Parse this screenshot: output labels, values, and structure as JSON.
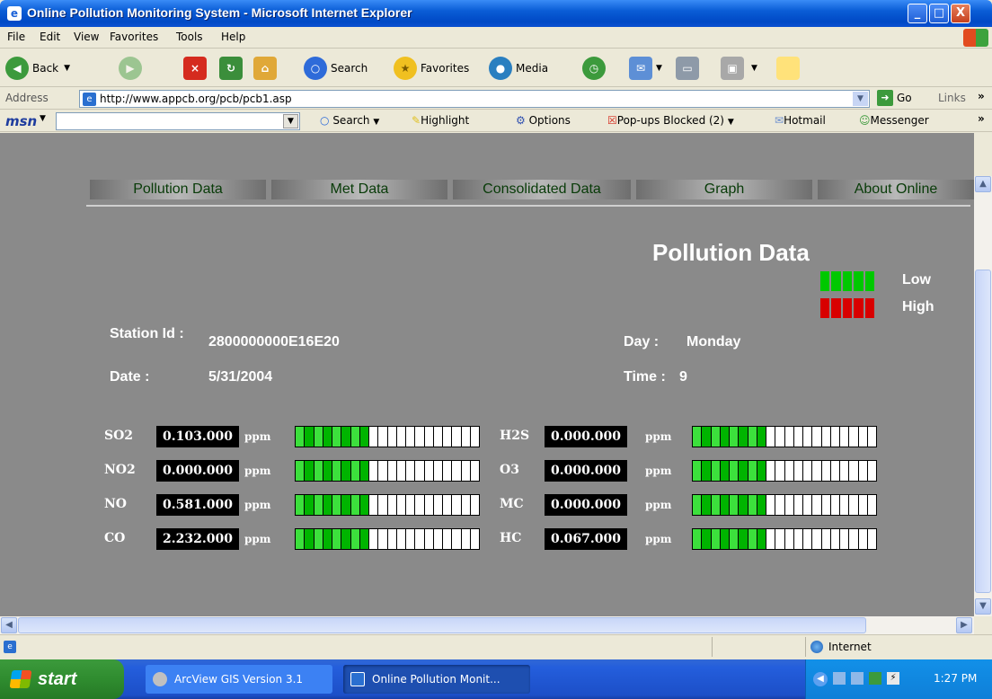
{
  "window": {
    "title": "Online Pollution Monitoring System - Microsoft Internet Explorer",
    "min": "_",
    "max": "□",
    "close": "X"
  },
  "menu": [
    "File",
    "Edit",
    "View",
    "Favorites",
    "Tools",
    "Help"
  ],
  "toolbar": {
    "back": "Back",
    "search": "Search",
    "favorites": "Favorites",
    "media": "Media"
  },
  "address": {
    "label": "Address",
    "url": "http://www.appcb.org/pcb/pcb1.asp",
    "go": "Go",
    "links": "Links"
  },
  "msn": {
    "logo": "msn",
    "search": "Search",
    "highlight": "Highlight",
    "options": "Options",
    "popups": "Pop-ups Blocked (2)",
    "hotmail": "Hotmail",
    "messenger": "Messenger"
  },
  "nav": [
    "Pollution Data",
    "Met Data",
    "Consolidated Data",
    "Graph",
    "About Online"
  ],
  "page": {
    "title": "Pollution Data",
    "legend": {
      "low": "Low",
      "high": "High",
      "low_color": "#00C800",
      "high_color": "#D80000"
    },
    "station_label": "Station Id :",
    "station_value": "2800000000E16E20",
    "date_label": "Date :",
    "date_value": "5/31/2004",
    "day_label": "Day :",
    "day_value": "Monday",
    "time_label": "Time :",
    "time_value": "9"
  },
  "readings_left": [
    {
      "name": "SO2",
      "value": "0.103.000",
      "unit": "ppm",
      "level": 0.4
    },
    {
      "name": "NO2",
      "value": "0.000.000",
      "unit": "ppm",
      "level": 0.4
    },
    {
      "name": "NO",
      "value": "0.581.000",
      "unit": "ppm",
      "level": 0.4
    },
    {
      "name": "CO",
      "value": "2.232.000",
      "unit": "ppm",
      "level": 0.4
    }
  ],
  "readings_right": [
    {
      "name": "H2S",
      "value": "0.000.000",
      "unit": "ppm",
      "level": 0.4
    },
    {
      "name": "O3",
      "value": "0.000.000",
      "unit": "ppm",
      "level": 0.4
    },
    {
      "name": "MC",
      "value": "0.000.000",
      "unit": "ppm",
      "level": 0.4
    },
    {
      "name": "HC",
      "value": "0.067.000",
      "unit": "ppm",
      "level": 0.4
    }
  ],
  "status": {
    "zone": "Internet"
  },
  "taskbar": {
    "start": "start",
    "tasks": [
      "ArcView GIS Version 3.1",
      "Online Pollution Monit..."
    ],
    "clock": "1:27 PM"
  }
}
